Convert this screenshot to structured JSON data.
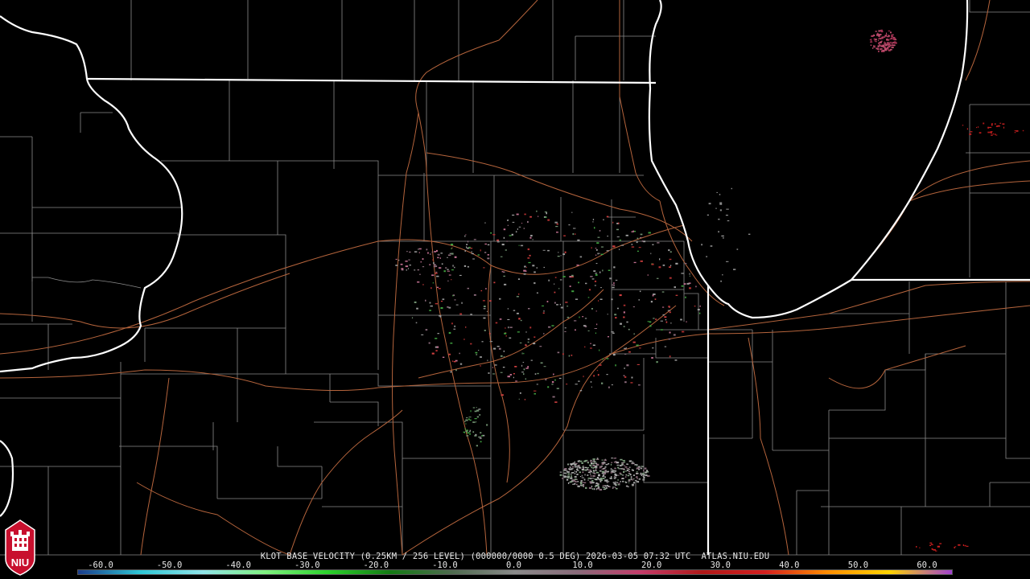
{
  "product_line": "KLOT BASE VELOCITY (0.25KM / 256 LEVEL) (000000/0000 0.5 DEG) 2026-03-05 07:32 UTC  ATLAS.NIU.EDU",
  "logo_text": "NIU",
  "colorbar": {
    "ticks": [
      "-60.0",
      "-50.0",
      "-40.0",
      "-30.0",
      "-20.0",
      "-10.0",
      "0.0",
      "10.0",
      "20.0",
      "30.0",
      "40.0",
      "50.0",
      "60.0"
    ],
    "gradient": [
      "#1a3c8c",
      "#2ec7d6",
      "#8fe3e8",
      "#7ff07f",
      "#2bd12b",
      "#137a13",
      "#4f6b4f",
      "#8a8a8a",
      "#8a6a7a",
      "#c43b6a",
      "#b01818",
      "#d41f1f",
      "#ff8c00",
      "#ffd400",
      "#a040d0"
    ]
  },
  "colors": {
    "state_borders": "#ffffff",
    "county_lines": "#8a8a8a",
    "highways": "#b5643c"
  }
}
